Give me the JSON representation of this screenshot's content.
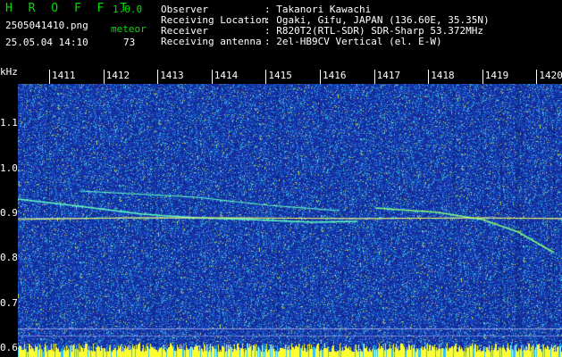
{
  "header": {
    "app_title": "H R O F F T",
    "version": "1.0.0",
    "filename": "2505041410.png",
    "datetime": "25.05.04 14:10",
    "meteor_label": "meteor",
    "meteor_count": "73",
    "observer_label": "Observer",
    "observer_value": ": Takanori Kawachi",
    "location_label": "Receiving Location",
    "location_value": ": Ogaki, Gifu, JAPAN (136.60E, 35.35N)",
    "receiver_label": "Receiver",
    "receiver_value": ": R820T2(RTL-SDR) SDR-Sharp 53.372MHz",
    "antenna_label": "Receiving antenna",
    "antenna_value": ": 2el-HB9CV Vertical (el. E-W)"
  },
  "axes": {
    "y_unit": "kHz",
    "x_ticks": [
      "1411",
      "1412",
      "1413",
      "1414",
      "1415",
      "1416",
      "1417",
      "1418",
      "1419",
      "1420"
    ],
    "y_ticks": [
      "1.1",
      "1.0",
      "0.9",
      "0.8",
      "0.7",
      "0.6"
    ],
    "y_range": [
      0.58,
      1.22
    ]
  },
  "colors": {
    "header_green": "#00e000",
    "header_white": "#ffffff",
    "background": "#1a3aa8",
    "signal_strong": "#ffff30",
    "signal_mid": "#40e0e0"
  }
}
